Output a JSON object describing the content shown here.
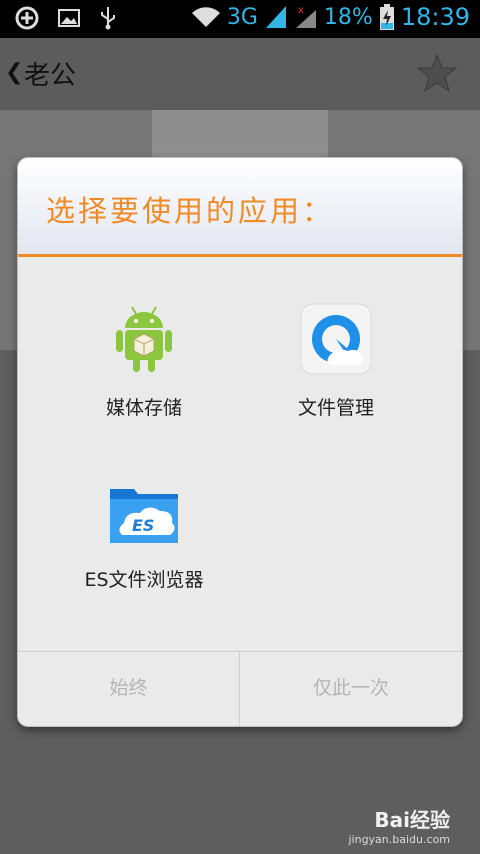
{
  "status_bar": {
    "network": "3G",
    "battery": "18%",
    "time": "18:39"
  },
  "contact": {
    "name": "老公"
  },
  "dialog": {
    "title": "选择要使用的应用：",
    "apps": [
      {
        "label": "媒体存储",
        "icon": "android-icon"
      },
      {
        "label": "文件管理",
        "icon": "qq-browser-icon"
      },
      {
        "label": "ES文件浏览器",
        "icon": "es-file-explorer-icon"
      }
    ],
    "buttons": {
      "always": "始终",
      "just_once": "仅此一次"
    }
  },
  "watermark": {
    "logo": "Bai经验",
    "url": "jingyan.baidu.com"
  },
  "colors": {
    "accent": "#f08a24",
    "status_icons": "#33b5e5"
  }
}
